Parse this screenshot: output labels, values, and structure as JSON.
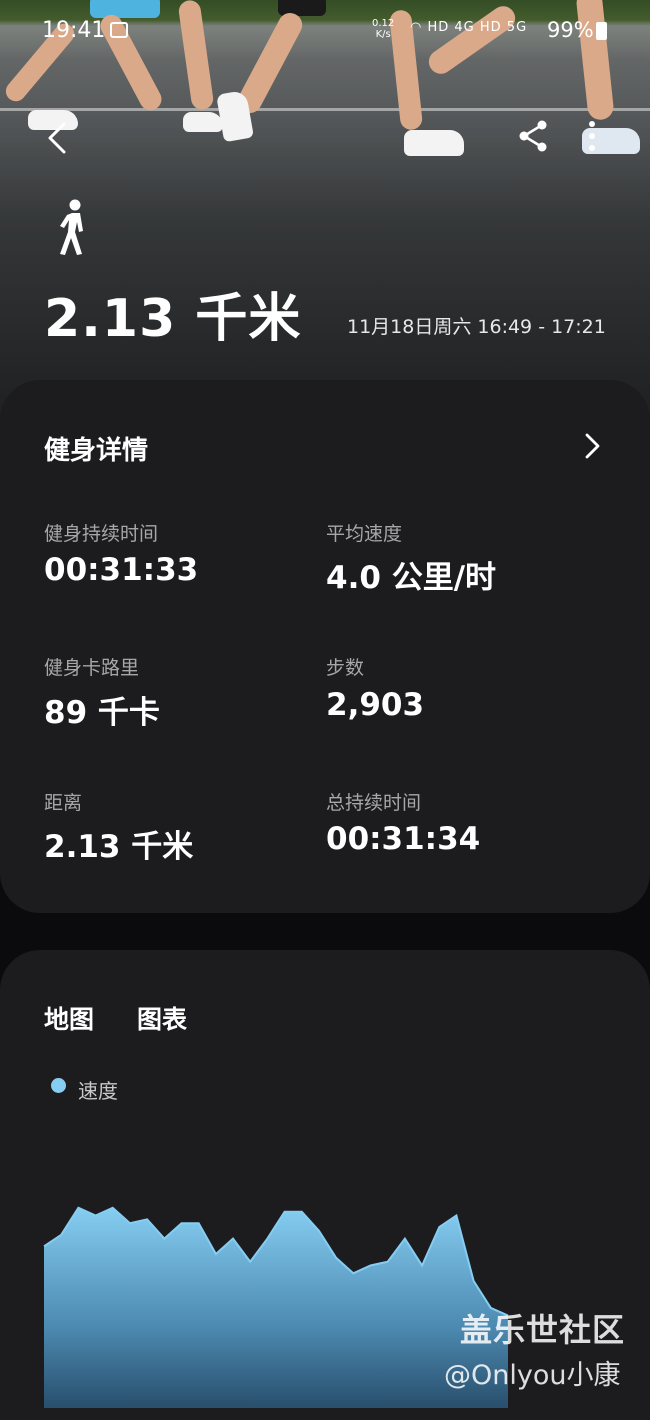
{
  "status_bar": {
    "time": "19:41",
    "net_speed": "0.12",
    "net_unit": "K/s",
    "net_icons": "HD 4G HD 5G",
    "battery": "99%"
  },
  "hero": {
    "activity_icon": "walking-person-icon",
    "distance": "2.13 千米",
    "date_range": "11月18日周六 16:49 - 17:21"
  },
  "details": {
    "title": "健身详情",
    "stats": [
      {
        "label": "健身持续时间",
        "value": "00:31:33"
      },
      {
        "label": "平均速度",
        "value": "4.0 公里/时"
      },
      {
        "label": "健身卡路里",
        "value": "89 千卡"
      },
      {
        "label": "步数",
        "value": "2,903"
      },
      {
        "label": "距离",
        "value": "2.13 千米"
      },
      {
        "label": "总持续时间",
        "value": "00:31:34"
      }
    ]
  },
  "tabs": {
    "map": "地图",
    "chart": "图表"
  },
  "chart_data": {
    "type": "area",
    "series": [
      {
        "name": "速度",
        "color": "#86cdf2",
        "values": [
          4.2,
          4.5,
          5.2,
          5.0,
          5.2,
          4.8,
          4.9,
          4.4,
          4.8,
          4.8,
          4.0,
          4.4,
          3.8,
          4.4,
          5.1,
          5.1,
          4.6,
          3.9,
          3.5,
          3.7,
          3.8,
          4.4,
          3.7,
          4.7,
          5.0,
          3.3,
          2.6,
          2.4
        ]
      }
    ],
    "ylim": [
      0,
      8
    ],
    "grid": false,
    "legend": "top-left"
  },
  "watermark": {
    "line1": "盖乐世社区",
    "line2": "@Onlyou小康"
  }
}
